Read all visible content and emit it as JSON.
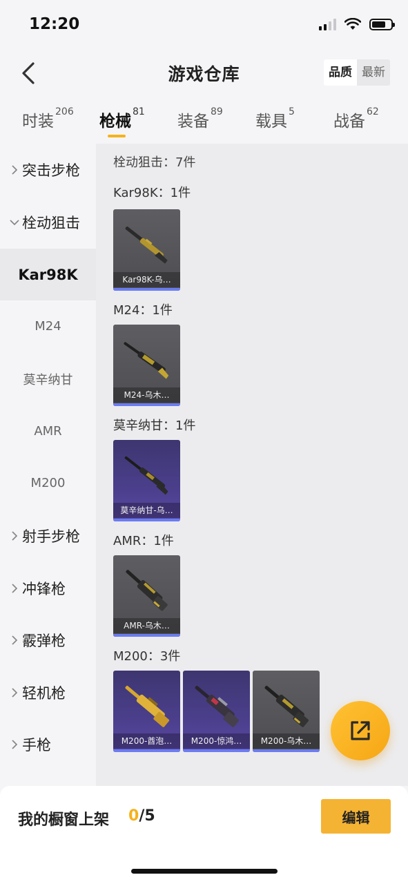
{
  "status": {
    "time": "12:20"
  },
  "header": {
    "title": "游戏仓库",
    "sort": {
      "quality": "品质",
      "latest": "最新"
    }
  },
  "tabs": [
    {
      "label": "时装",
      "count": "206"
    },
    {
      "label": "枪械",
      "count": "81"
    },
    {
      "label": "装备",
      "count": "89"
    },
    {
      "label": "载具",
      "count": "5"
    },
    {
      "label": "战备",
      "count": "62"
    }
  ],
  "sidebar": {
    "categories": [
      "突击步枪",
      "栓动狙击",
      "射手步枪",
      "冲锋枪",
      "霰弹枪",
      "轻机枪",
      "手枪"
    ],
    "subs": [
      "Kar98K",
      "M24",
      "莫辛纳甘",
      "AMR",
      "M200"
    ]
  },
  "main": {
    "summary": "栓动狙击：7件",
    "groups": [
      {
        "label": "Kar98K：1件",
        "items": [
          "Kar98K-乌…"
        ]
      },
      {
        "label": "M24：1件",
        "items": [
          "M24-乌木…"
        ]
      },
      {
        "label": "莫辛纳甘：1件",
        "items": [
          "莫辛纳甘-乌…"
        ]
      },
      {
        "label": "AMR：1件",
        "items": [
          "AMR-乌木…"
        ]
      },
      {
        "label": "M200：3件",
        "items": [
          "M200-酋泡…",
          "M200-惊鸿…",
          "M200-乌木…"
        ]
      }
    ]
  },
  "bottom": {
    "shelf_label": "我的橱窗上架",
    "used": "0",
    "total": "/5",
    "edit": "编辑"
  },
  "colors": {
    "accent": "#f5b21c",
    "rarity_bar": "#6a7cf0",
    "purple_card": "#4b3f8c",
    "gray_card": "#56565a"
  }
}
